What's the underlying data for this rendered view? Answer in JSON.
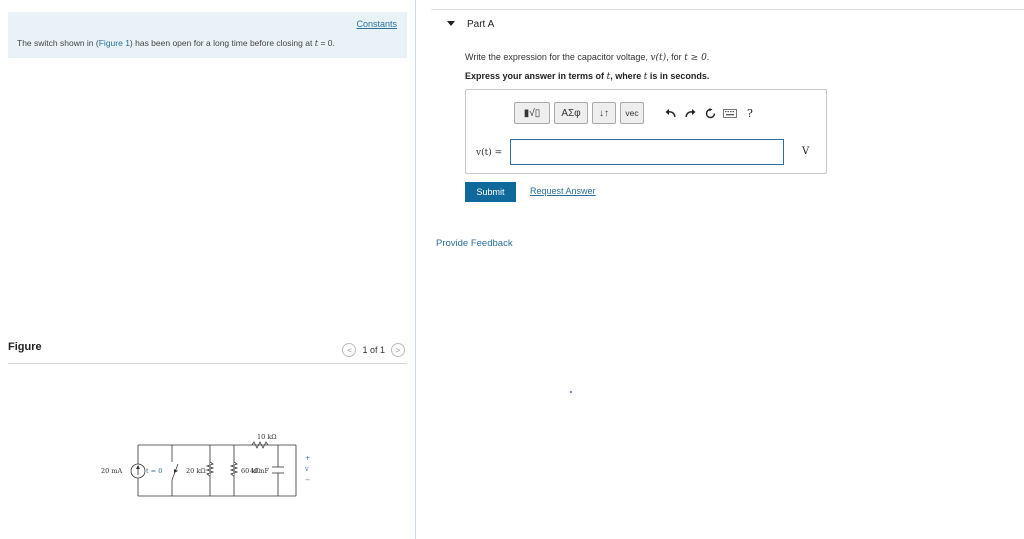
{
  "left": {
    "constants_link": "Constants",
    "problem_prefix": "The switch shown in (",
    "figure_link": "Figure 1",
    "problem_suffix": ") has been open for a long time before closing at ",
    "problem_var": "t",
    "problem_end": " = 0.",
    "figure_title": "Figure",
    "pager_text": "1 of 1",
    "circuit": {
      "source_label": "20 mA",
      "switch_label": "t = 0",
      "r1_label": "20 kΩ",
      "r_top_label": "10 kΩ",
      "r2_label": "60 kΩ",
      "cap_label": "40 nF",
      "plus": "+",
      "minus": "−",
      "v_label": "v"
    }
  },
  "right": {
    "part_title": "Part A",
    "question_prefix": "Write the expression for the capacitor voltage, ",
    "question_var": "v(t)",
    "question_mid": ", for ",
    "question_cond": "t ≥ 0",
    "question_end": ".",
    "instruction_prefix": "Express your answer in terms of ",
    "instruction_var1": "t",
    "instruction_mid": ", where ",
    "instruction_var2": "t",
    "instruction_end": " is in seconds.",
    "toolbar": {
      "templates": "▮√▯",
      "greek": "ΑΣφ",
      "arrows": "↓↑",
      "vec": "vec",
      "help": "?"
    },
    "var_label": "v(t) =",
    "unit": "V",
    "submit_label": "Submit",
    "request_label": "Request Answer",
    "feedback_label": "Provide Feedback"
  }
}
